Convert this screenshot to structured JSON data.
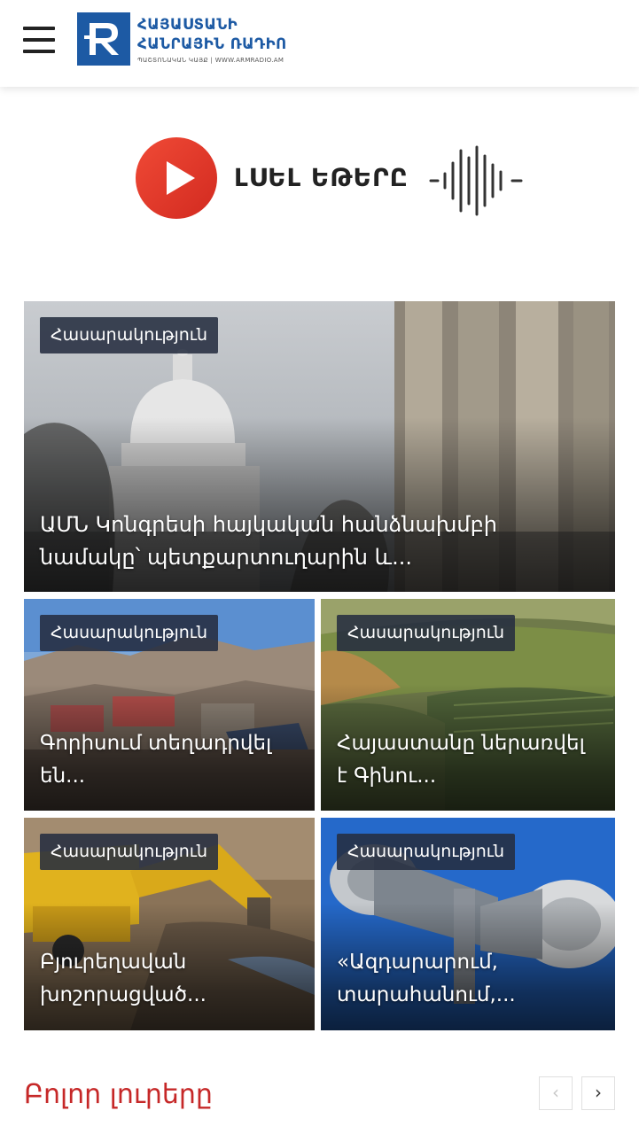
{
  "header": {
    "logo": {
      "line1": "ՀԱՅԱՍՏԱՆԻ",
      "line2": "ՀԱՆՐԱՅԻՆ ՌԱԴԻՈ",
      "sub": "ՊԱՇՏՈՆԱԿԱՆ ԿԱՅՔ | WWW.ARMRADIO.AM"
    },
    "menu_icon": "hamburger-icon"
  },
  "live": {
    "label": "ԼՍԵԼ ԵԹԵՐԸ",
    "play_color": "#e8332a"
  },
  "news": [
    {
      "category": "Հասարակություն",
      "title": "ԱՄՆ Կոնգրեսի հայկական հանձնախմբի նամակը՝ պետքարտուղարին և..."
    },
    {
      "category": "Հասարակություն",
      "title": "Գորիսում տեղադրվել են..."
    },
    {
      "category": "Հասարակություն",
      "title": "Հայաստանը ներառվել է Գինու..."
    },
    {
      "category": "Հասարակություն",
      "title": "Բյուրեղավան խոշորացված..."
    },
    {
      "category": "Հասարակություն",
      "title": "«Ազդարարում, տարահանում,..."
    }
  ],
  "section": {
    "all_news": "Բոլոր լուրերը",
    "prev_icon": "chevron-left-icon",
    "next_icon": "chevron-right-icon",
    "prev_symbol": "‹",
    "next_symbol": "›"
  },
  "colors": {
    "brand_blue": "#1d5aa4",
    "accent_red": "#c62828",
    "tag_bg": "#262e40"
  }
}
